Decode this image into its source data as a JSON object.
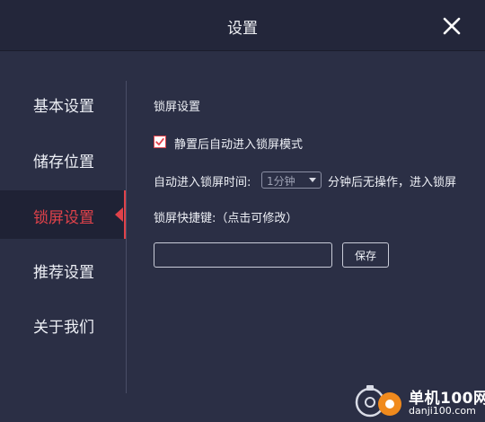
{
  "window": {
    "title": "设置"
  },
  "sidebar": {
    "items": [
      {
        "label": "基本设置",
        "active": false
      },
      {
        "label": "储存位置",
        "active": false
      },
      {
        "label": "锁屏设置",
        "active": true
      },
      {
        "label": "推荐设置",
        "active": false
      },
      {
        "label": "关于我们",
        "active": false
      }
    ]
  },
  "lock_screen": {
    "section_title": "锁屏设置",
    "auto_lock_label": "静置后自动进入锁屏模式",
    "auto_lock_checked": true,
    "time_label": "自动进入锁屏时间:",
    "time_value": "1分钟",
    "time_suffix": "分钟后无操作，进入锁屏",
    "hotkey_label": "锁屏快捷键:（点击可修改）",
    "hotkey_value": "",
    "save_label": "保存"
  },
  "watermark": {
    "name": "单机100网",
    "url": "danji100.com"
  },
  "colors": {
    "accent": "#e0424a",
    "background": "#2b2f45",
    "titlebar": "#23263a",
    "watermark_orange": "#f08a1d"
  },
  "icons": {
    "close": "close-icon",
    "check": "checkmark-icon",
    "dropdown": "chevron-down-icon",
    "active_marker": "arrow-left-icon"
  }
}
